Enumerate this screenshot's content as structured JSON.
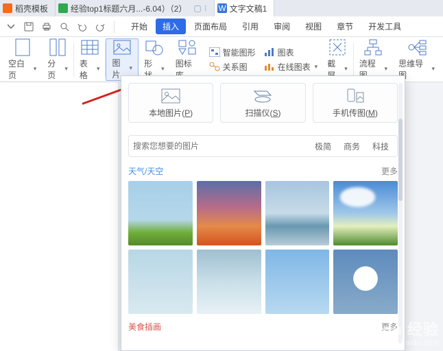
{
  "docTabs": [
    {
      "icon": "orange",
      "label": "稻壳模板"
    },
    {
      "icon": "green",
      "label": "经验top1标题六月...-6.04）（2）"
    },
    {
      "icon": "blue",
      "label": "文字文稿1"
    }
  ],
  "menu": {
    "start": "开始",
    "insert": "插入",
    "layout": "页面布局",
    "reference": "引用",
    "review": "审阅",
    "view": "视图",
    "chapter": "章节",
    "devtools": "开发工具"
  },
  "ribbon": {
    "blank": "空白页",
    "page_break": "分页",
    "table": "表格",
    "picture": "图片",
    "shape": "形状",
    "iconlib": "图标库",
    "smart": "智能图形",
    "chart": "图表",
    "relation": "关系图",
    "onlinechart": "在线图表",
    "screenshot": "截屏",
    "flowchart": "流程图",
    "mindmap": "思维导图"
  },
  "popover": {
    "local": {
      "label": "本地图片(",
      "key": "P",
      "suffix": ")"
    },
    "scanner": {
      "label": "扫描仪(",
      "key": "S",
      "suffix": ")"
    },
    "phone": {
      "label": "手机传图(",
      "key": "M",
      "suffix": ")"
    },
    "search_placeholder": "搜索您想要的图片",
    "chips": {
      "minimal": "极简",
      "business": "商务",
      "tech": "科技"
    },
    "section1": {
      "title": "天气/天空",
      "more": "更多"
    },
    "section2": {
      "title": "美食插画",
      "more": "更多"
    }
  },
  "watermark": {
    "brand": "Baidu 经验",
    "url": "jingyan.baidu.com"
  }
}
